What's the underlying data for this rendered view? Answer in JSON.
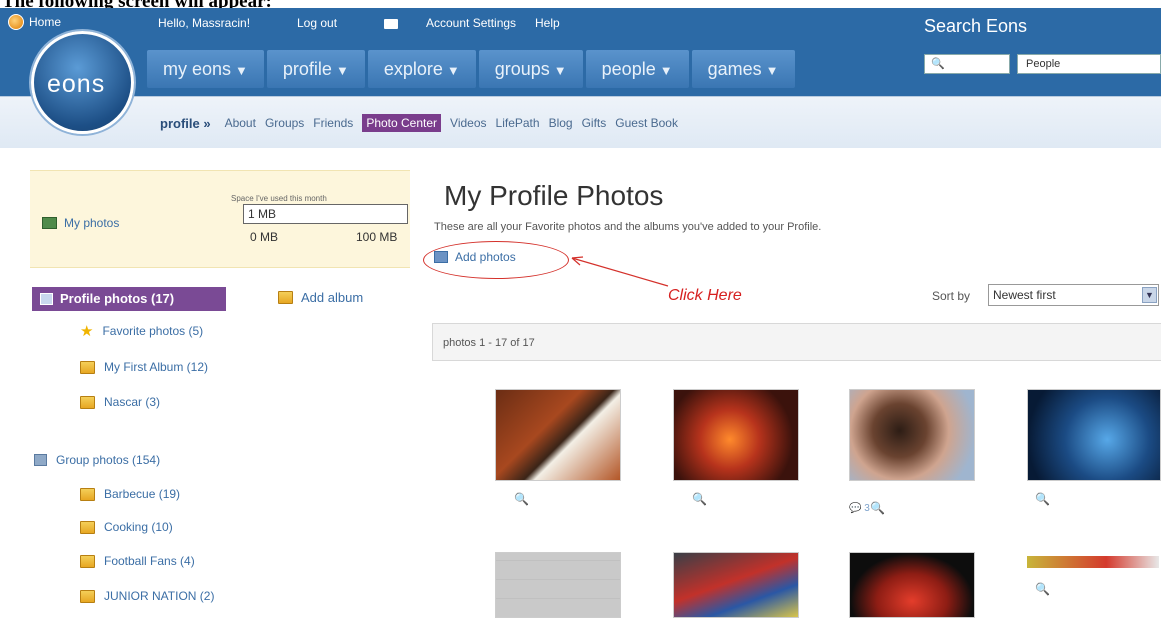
{
  "caption": "The following screen will appear:",
  "header": {
    "home": "Home",
    "greeting": "Hello, Massracin!",
    "logout": "Log out",
    "account_settings": "Account Settings",
    "help": "Help",
    "logo": "eons",
    "search_title": "Search Eons",
    "search_select": "People"
  },
  "nav": [
    {
      "label": "my eons"
    },
    {
      "label": "profile"
    },
    {
      "label": "explore"
    },
    {
      "label": "groups"
    },
    {
      "label": "people"
    },
    {
      "label": "games"
    }
  ],
  "subnav": {
    "title": "profile »",
    "links": [
      "About",
      "Groups",
      "Friends",
      "Photo Center",
      "Videos",
      "LifePath",
      "Blog",
      "Gifts",
      "Guest Book"
    ],
    "active": "Photo Center"
  },
  "sidebar": {
    "my_photos": "My photos",
    "space_note": "Space I've used this month",
    "usage_value": "1 MB",
    "usage_min": "0 MB",
    "usage_max": "100 MB",
    "profile_photos": "Profile photos (17)",
    "add_album": "Add album",
    "profile_albums": [
      "Favorite photos (5)",
      "My First Album (12)",
      "Nascar (3)"
    ],
    "group_photos": "Group photos (154)",
    "group_albums": [
      "Barbecue (19)",
      "Cooking (10)",
      "Football Fans (4)",
      "JUNIOR NATION (2)"
    ]
  },
  "main": {
    "title": "My Profile Photos",
    "description": "These are all your Favorite photos and the albums you've added to your Profile.",
    "add_photos": "Add photos",
    "annotation": "Click Here",
    "sort_label": "Sort by",
    "sort_value": "Newest first",
    "count": "photos 1 - 17 of 17",
    "comment_count": "3"
  },
  "colors": {
    "header_blue": "#2c6aa6",
    "accent_purple": "#7a4a95",
    "annotation_red": "#d62020"
  }
}
